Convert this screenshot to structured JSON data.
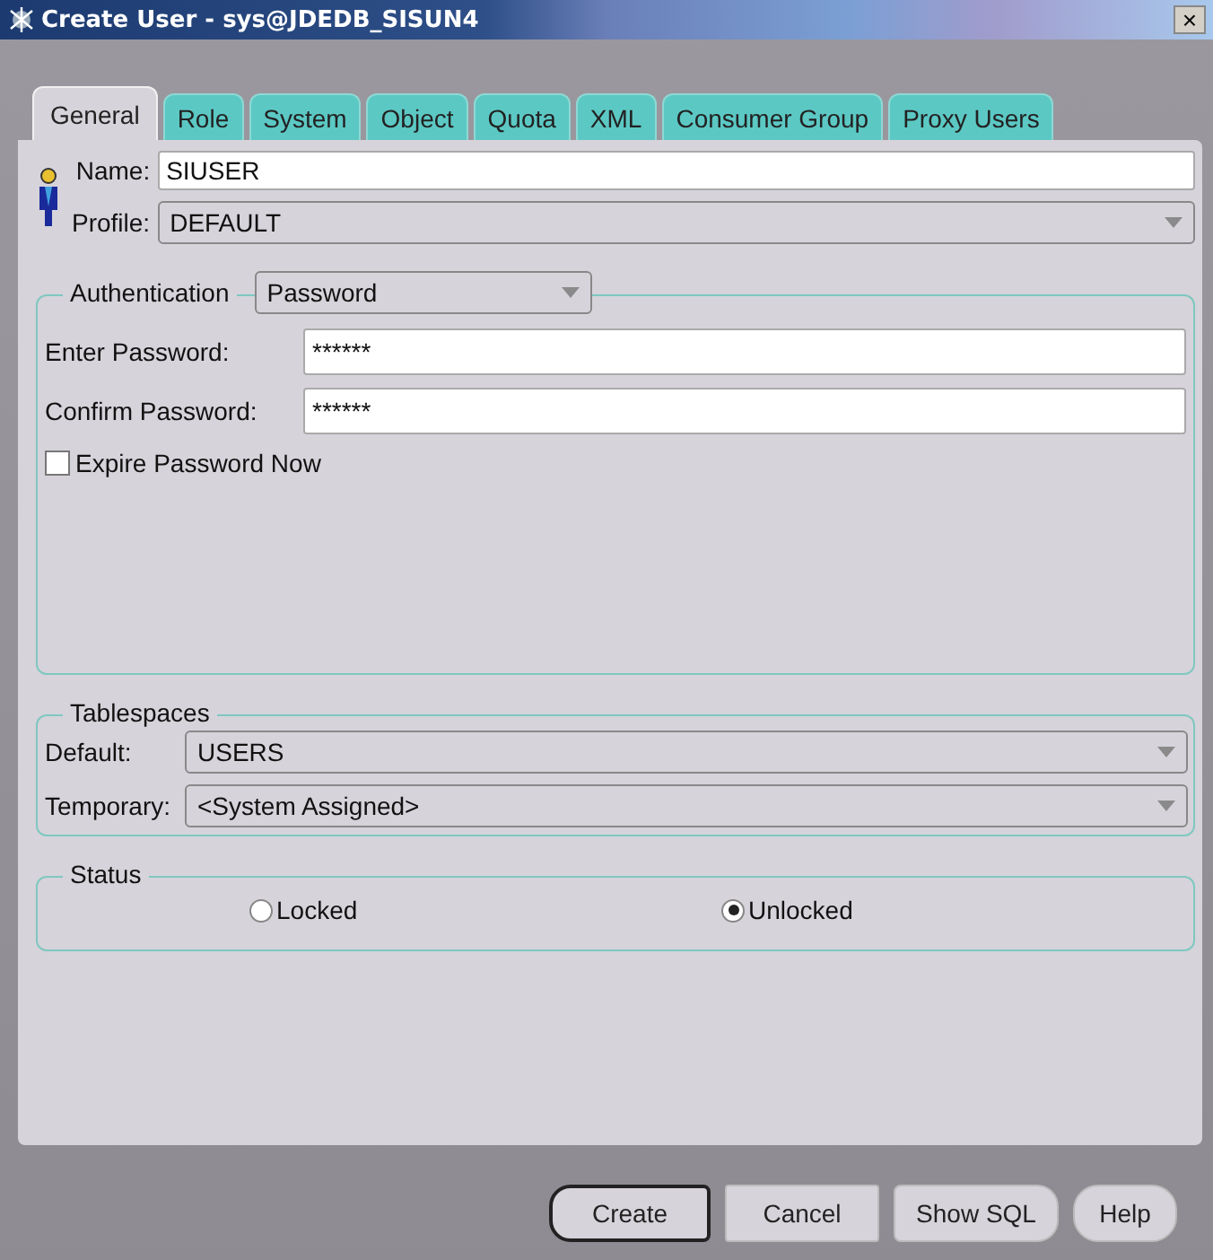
{
  "window": {
    "title": "Create User - sys@JDEDB_SISUN4",
    "close": "×"
  },
  "tabs": [
    {
      "label": "General",
      "selected": true
    },
    {
      "label": "Role",
      "selected": false
    },
    {
      "label": "System",
      "selected": false
    },
    {
      "label": "Object",
      "selected": false
    },
    {
      "label": "Quota",
      "selected": false
    },
    {
      "label": "XML",
      "selected": false
    },
    {
      "label": "Consumer Group",
      "selected": false
    },
    {
      "label": "Proxy Users",
      "selected": false
    }
  ],
  "user": {
    "name_label": "Name:",
    "name_value": "SIUSER",
    "profile_label": "Profile:",
    "profile_value": "DEFAULT"
  },
  "authentication": {
    "legend": "Authentication",
    "method": "Password",
    "fields": [
      {
        "label": "Enter Password:",
        "value": "******"
      },
      {
        "label": "Confirm Password:",
        "value": "******"
      }
    ],
    "expire": {
      "label": "Expire Password Now",
      "checked": false
    }
  },
  "tablespaces": {
    "legend": "Tablespaces",
    "fields": [
      {
        "label": "Default:",
        "value": "USERS"
      },
      {
        "label": "Temporary:",
        "value": "<System Assigned>"
      }
    ]
  },
  "status": {
    "legend": "Status",
    "options": [
      {
        "label": "Locked",
        "selected": false
      },
      {
        "label": "Unlocked",
        "selected": true
      }
    ]
  },
  "buttons": [
    {
      "label": "Create",
      "default": true
    },
    {
      "label": "Cancel",
      "default": false
    },
    {
      "label": "Show SQL",
      "default": false
    },
    {
      "label": "Help",
      "default": false
    }
  ]
}
